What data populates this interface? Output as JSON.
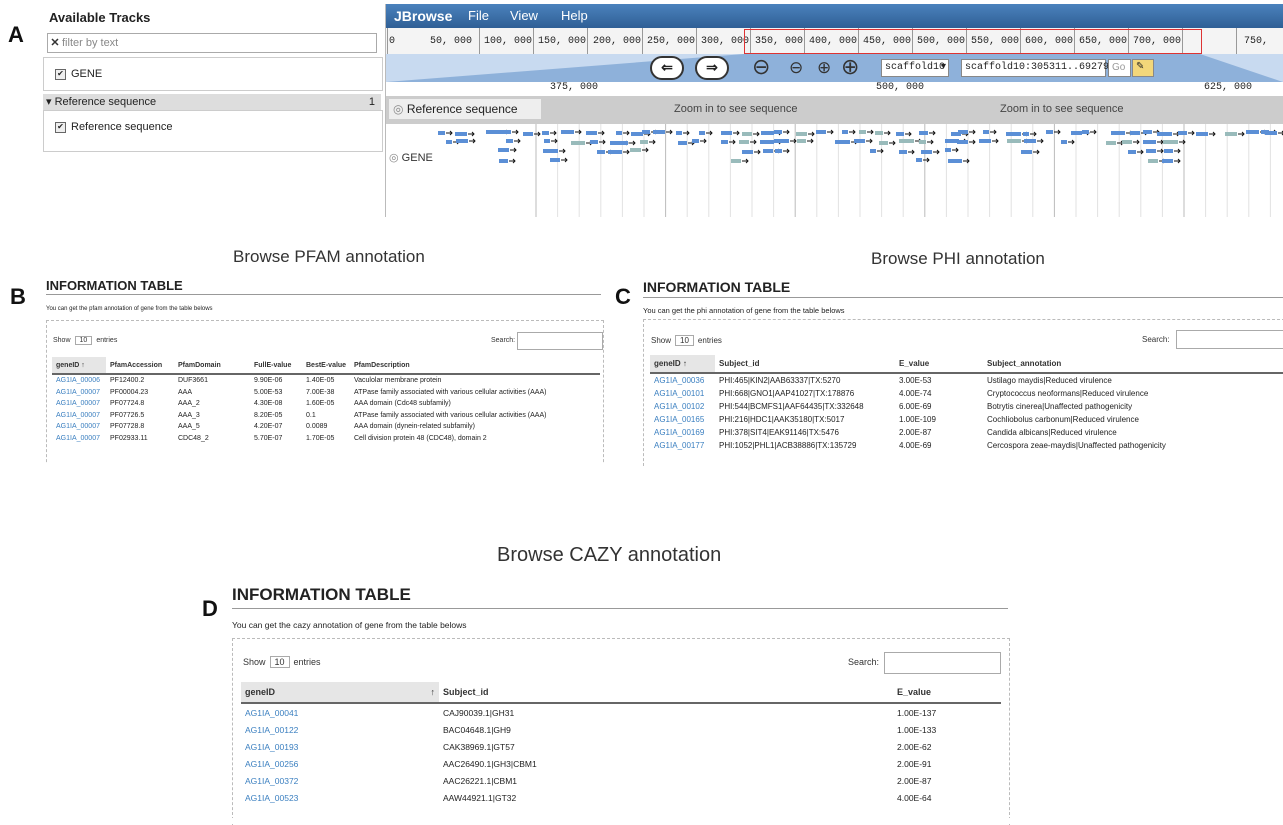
{
  "panel_letters": [
    "A",
    "B",
    "C",
    "D"
  ],
  "jbrowse": {
    "tracks_title": "Available Tracks",
    "filter_placeholder": "filter by text",
    "track_gene": "GENE",
    "category_label": "Reference sequence",
    "category_count": "1",
    "track_reference": "Reference sequence",
    "brand": "JBrowse",
    "menu": [
      "File",
      "View",
      "Help"
    ],
    "ruler_ticks": [
      "0",
      "50, 000",
      "100, 000",
      "150, 000",
      "200, 000",
      "250, 000",
      "300, 000",
      "350, 000",
      "400, 000",
      "450, 000",
      "500, 000",
      "550, 000",
      "600, 000",
      "650, 000",
      "700, 000",
      "750,"
    ],
    "ref_select": "scaffold10",
    "location": "scaffold10:305311..69279",
    "go_label": "Go",
    "scale_ticks": [
      "375, 000",
      "500, 000",
      "625, 000"
    ],
    "ref_track_label": "Reference sequence",
    "zoom_message": "Zoom in to see sequence",
    "gene_track_label": "GENE",
    "accent_color": "#3a6ea5"
  },
  "pfam": {
    "caption": "Browse PFAM annotation",
    "title": "INFORMATION TABLE",
    "subtitle": "You can get the pfam annotation of gene from the table belows",
    "show_label": "Show",
    "show_value": "10",
    "entries_label": "entries",
    "search_label": "Search:",
    "columns": [
      "geneID",
      "PfamAccession",
      "PfamDomain",
      "FullE-value",
      "BestE-value",
      "PfamDescription"
    ],
    "sort_indicator": "↑",
    "rows": [
      [
        "AG1IA_00006",
        "PF12400.2",
        "DUF3661",
        "9.90E-06",
        "1.40E-05",
        "Vaculolar membrane protein"
      ],
      [
        "AG1IA_00007",
        "PF00004.23",
        "AAA",
        "5.00E-53",
        "7.00E-38",
        "ATPase family associated with various cellular activities (AAA)"
      ],
      [
        "AG1IA_00007",
        "PF07724.8",
        "AAA_2",
        "4.30E-08",
        "1.60E-05",
        "AAA domain (Cdc48 subfamily)"
      ],
      [
        "AG1IA_00007",
        "PF07726.5",
        "AAA_3",
        "8.20E-05",
        "0.1",
        "ATPase family associated with various cellular activities (AAA)"
      ],
      [
        "AG1IA_00007",
        "PF07728.8",
        "AAA_5",
        "4.20E-07",
        "0.0089",
        "AAA domain (dynein-related subfamily)"
      ],
      [
        "AG1IA_00007",
        "PF02933.11",
        "CDC48_2",
        "5.70E-07",
        "1.70E-05",
        "Cell division protein 48 (CDC48), domain 2"
      ]
    ]
  },
  "phi": {
    "caption": "Browse PHI annotation",
    "title": "INFORMATION TABLE",
    "subtitle": "You can get the phi annotation of gene from the table belows",
    "show_label": "Show",
    "show_value": "10",
    "entries_label": "entries",
    "search_label": "Search:",
    "columns": [
      "geneID",
      "Subject_id",
      "E_value",
      "Subject_annotation"
    ],
    "sort_indicator": "↑",
    "rows": [
      [
        "AG1IA_00036",
        "PHI:465|KIN2|AAB63337|TX:5270",
        "3.00E-53",
        "Ustilago maydis|Reduced virulence"
      ],
      [
        "AG1IA_00101",
        "PHI:668|GNO1|AAP41027|TX:178876",
        "4.00E-74",
        "Cryptococcus neoformans|Reduced virulence"
      ],
      [
        "AG1IA_00102",
        "PHI:544|BCMFS1|AAF64435|TX:332648",
        "6.00E-69",
        "Botrytis cinerea|Unaffected pathogenicity"
      ],
      [
        "AG1IA_00165",
        "PHI:216|HDC1|AAK35180|TX:5017",
        "1.00E-109",
        "Cochliobolus carbonum|Reduced virulence"
      ],
      [
        "AG1IA_00169",
        "PHI:378|SIT4|EAK91146|TX:5476",
        "2.00E-87",
        "Candida albicans|Reduced virulence"
      ],
      [
        "AG1IA_00177",
        "PHI:1052|PHL1|ACB38886|TX:135729",
        "4.00E-69",
        "Cercospora zeae-maydis|Unaffected pathogenicity"
      ]
    ]
  },
  "cazy": {
    "caption": "Browse CAZY annotation",
    "title": "INFORMATION TABLE",
    "subtitle": "You can get the cazy annotation of gene from the table belows",
    "show_label": "Show",
    "show_value": "10",
    "entries_label": "entries",
    "search_label": "Search:",
    "columns": [
      "geneID",
      "Subject_id",
      "E_value"
    ],
    "sort_indicator": "↑",
    "rows": [
      [
        "AG1IA_00041",
        "CAJ90039.1|GH31",
        "1.00E-137"
      ],
      [
        "AG1IA_00122",
        "BAC04648.1|GH9",
        "1.00E-133"
      ],
      [
        "AG1IA_00193",
        "CAK38969.1|GT57",
        "2.00E-62"
      ],
      [
        "AG1IA_00256",
        "AAC26490.1|GH3|CBM1",
        "2.00E-91"
      ],
      [
        "AG1IA_00372",
        "AAC26221.1|CBM1",
        "2.00E-87"
      ],
      [
        "AG1IA_00523",
        "AAW44921.1|GT32",
        "4.00E-64"
      ]
    ]
  }
}
